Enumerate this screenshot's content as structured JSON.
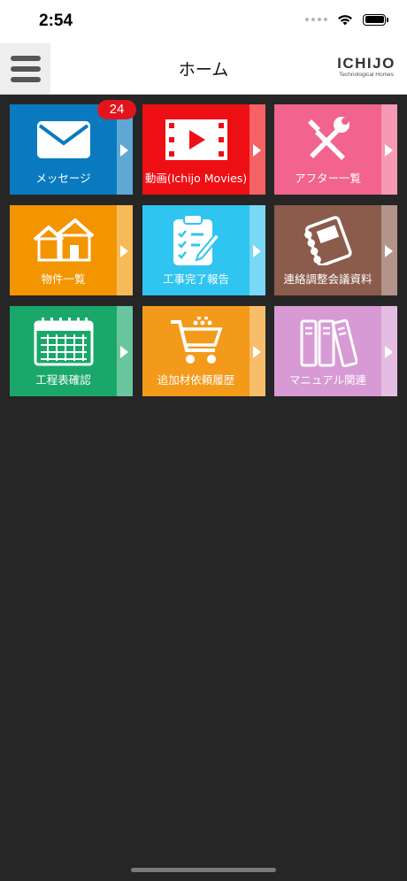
{
  "status": {
    "time": "2:54"
  },
  "header": {
    "title": "ホーム",
    "logo_main": "ICHIJO",
    "logo_sub": "Technological Homes"
  },
  "tiles": [
    {
      "label": "メッセージ",
      "badge": "24",
      "color": "#0a7ac0",
      "icon": "mail-icon"
    },
    {
      "label": "動画(Ichijo Movies)",
      "color": "#ee0f14",
      "icon": "video-icon"
    },
    {
      "label": "アフター一覧",
      "color": "#f2638e",
      "icon": "tools-icon"
    },
    {
      "label": "物件一覧",
      "color": "#f39500",
      "icon": "houses-icon"
    },
    {
      "label": "工事完了報告",
      "color": "#30c4f1",
      "icon": "clipboard-icon"
    },
    {
      "label": "連絡調整会議資料",
      "color": "#8b5b4c",
      "icon": "notebook-icon"
    },
    {
      "label": "工程表確認",
      "color": "#1aa86a",
      "icon": "calendar-icon"
    },
    {
      "label": "追加材依頼履歴",
      "color": "#f39a1a",
      "icon": "cart-icon"
    },
    {
      "label": "マニュアル関連",
      "color": "#d79ad4",
      "icon": "binders-icon"
    }
  ]
}
